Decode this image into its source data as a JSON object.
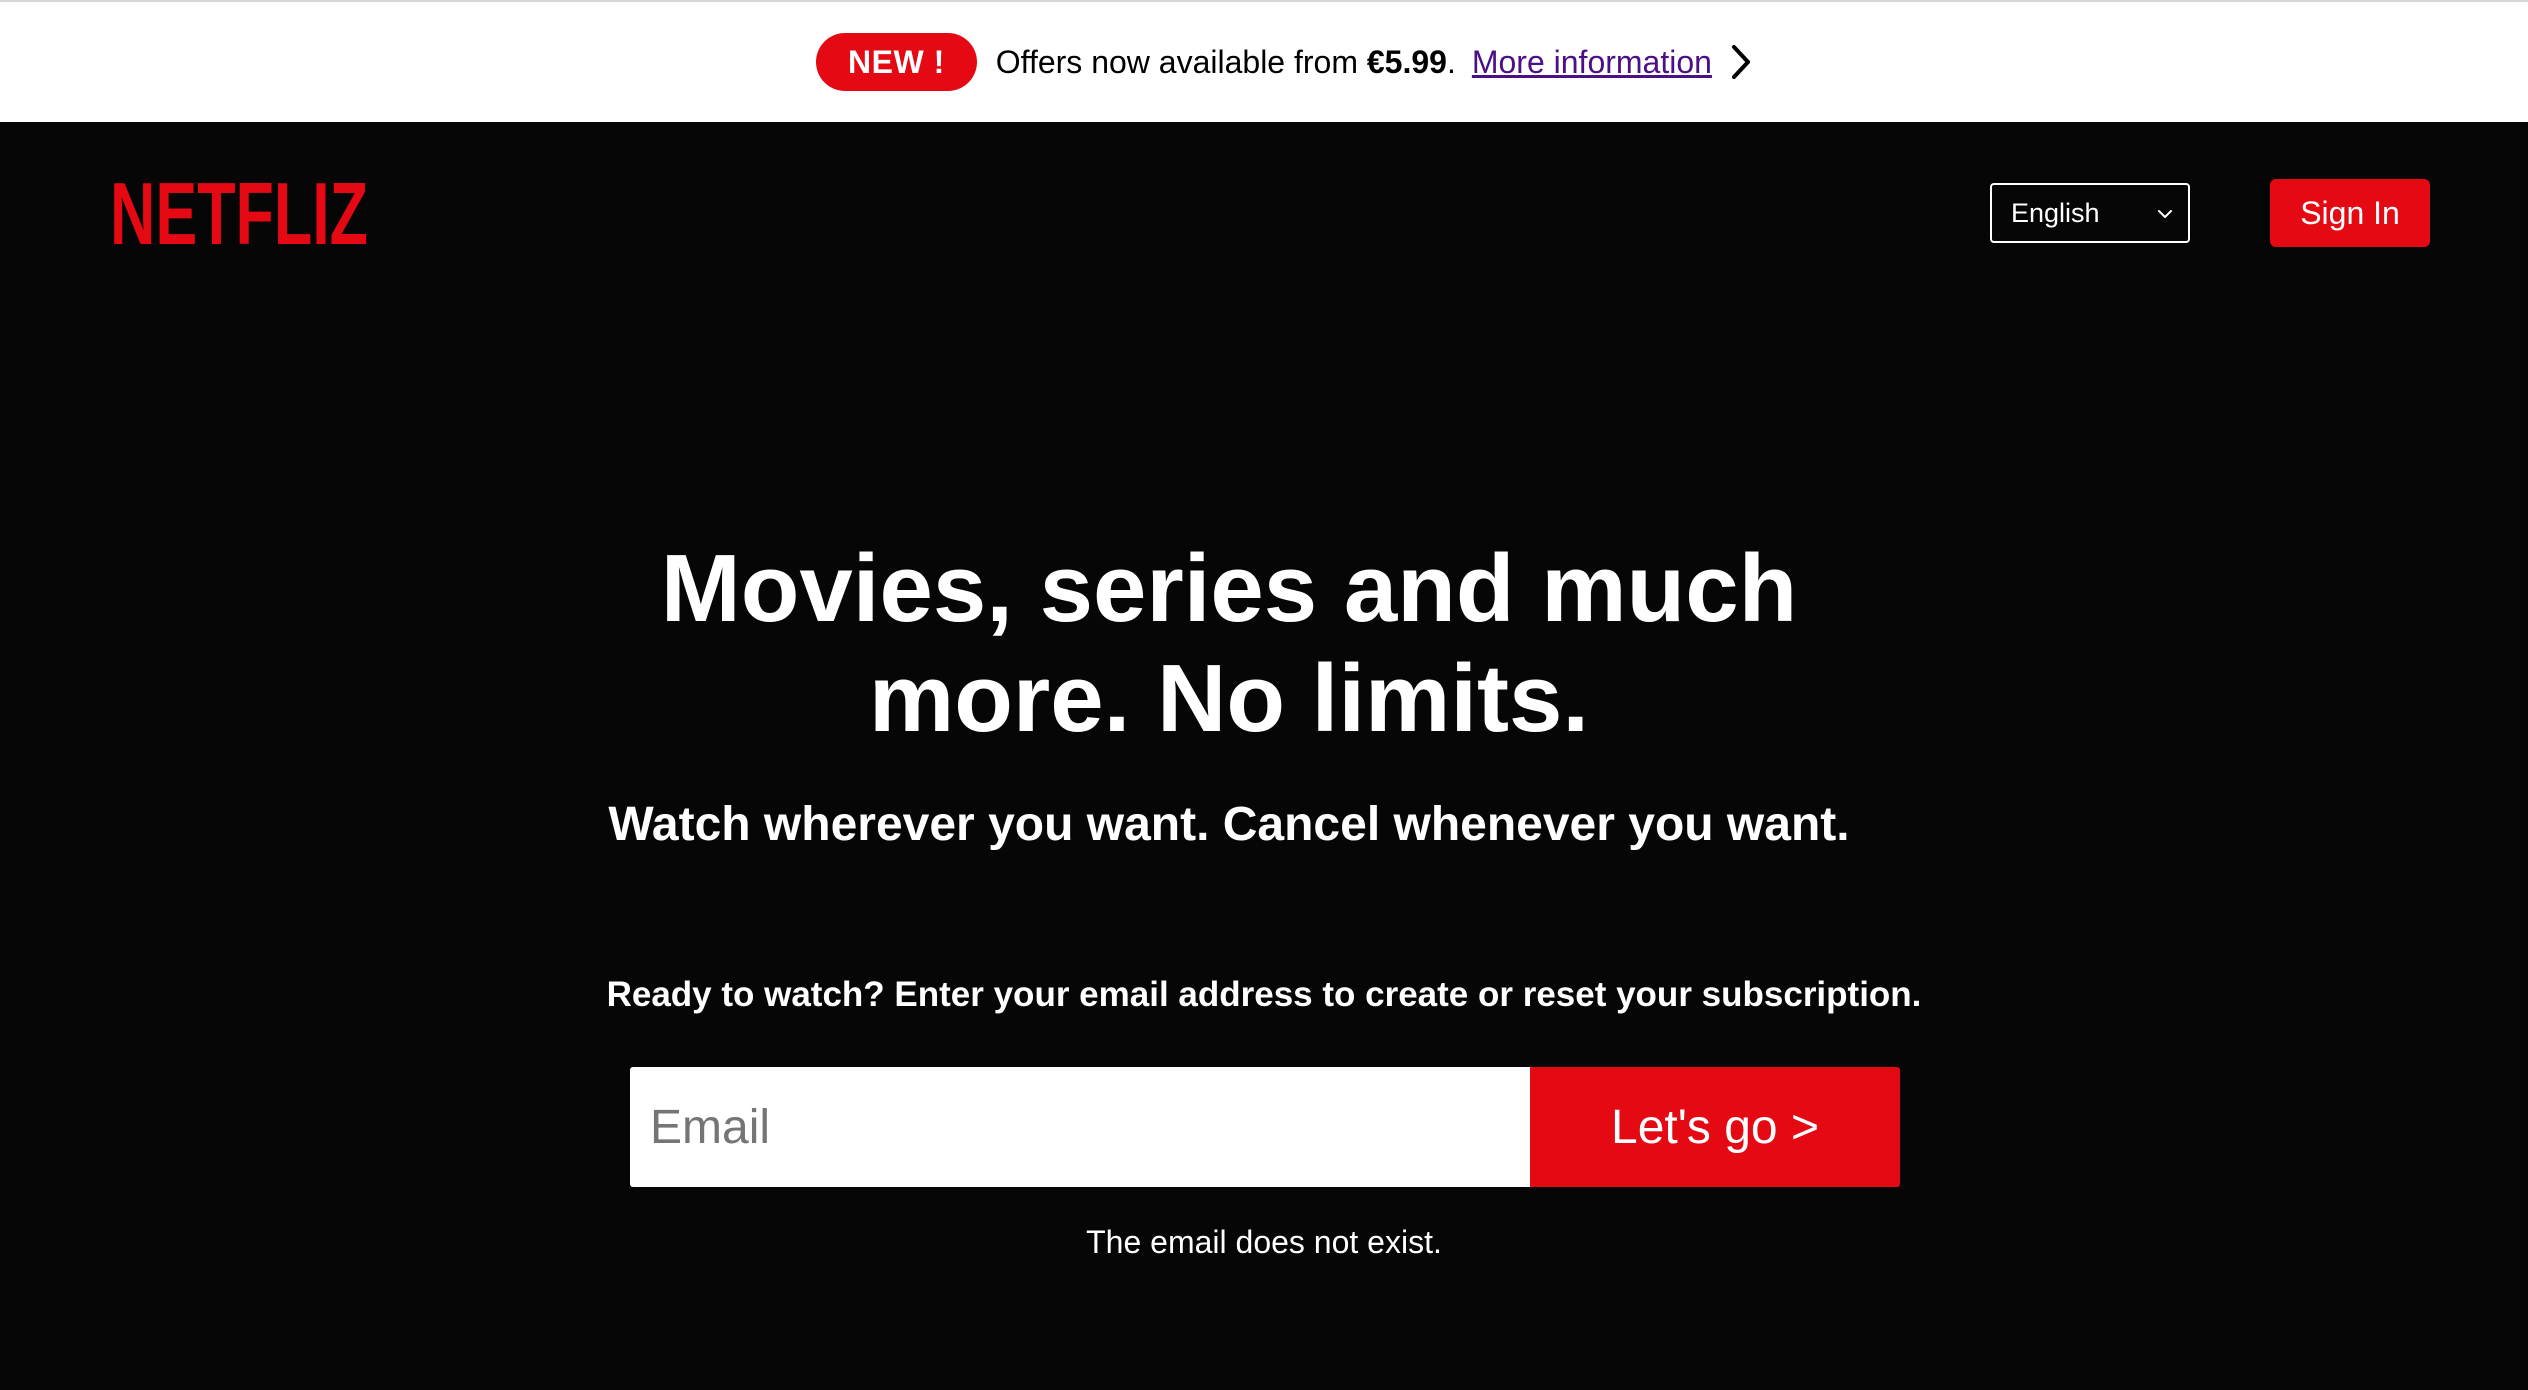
{
  "promo": {
    "badge": "NEW !",
    "text_prefix": "Offers now available from ",
    "price": "€5.99",
    "text_suffix": ".",
    "link_label": "More information",
    "chevron_icon": "chevron-right-icon"
  },
  "header": {
    "logo_text": "NETFLIZ",
    "language_selected": "English",
    "signin_label": "Sign In"
  },
  "hero": {
    "title": "Movies, series and much more. No limits.",
    "subtitle": "Watch wherever you want. Cancel whenever you want.",
    "prompt": "Ready to watch? Enter your email address to create or reset your subscription.",
    "email_placeholder": "Email",
    "email_value": "",
    "cta_label": "Let's go >",
    "error_message": "The email does not exist."
  },
  "colors": {
    "brand_red": "#e50914",
    "background": "#060606",
    "banner_bg": "#ffffff",
    "link_purple": "#4b0f86"
  }
}
